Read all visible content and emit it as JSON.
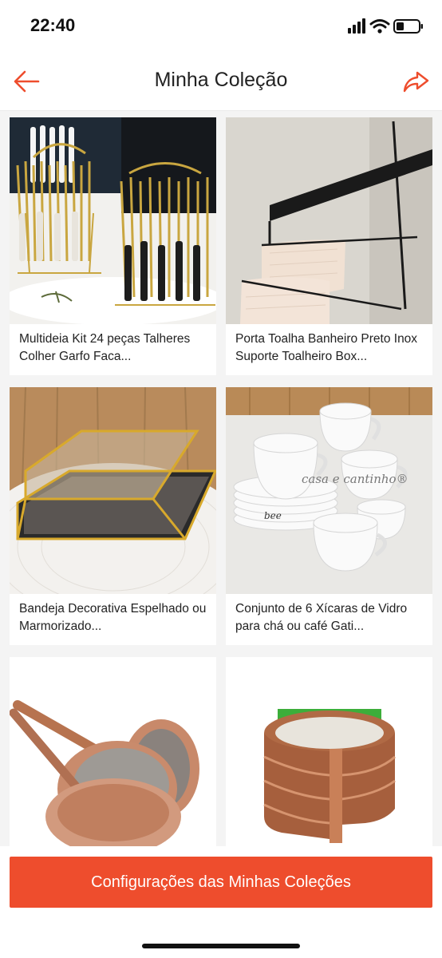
{
  "status_bar": {
    "time": "22:40"
  },
  "nav": {
    "title": "Minha Coleção",
    "back_icon": "arrow-left-icon",
    "share_icon": "share-icon"
  },
  "colors": {
    "accent": "#ee4d2d"
  },
  "products": [
    {
      "title": "Multideia Kit 24 peças Talheres Colher Garfo Faca...",
      "image": "cutlery-set-image"
    },
    {
      "title": "Porta Toalha Banheiro Preto Inox Suporte Toalheiro Box...",
      "image": "towel-rack-image"
    },
    {
      "title": "Bandeja Decorativa Espelhado ou Marmorizado...",
      "image": "mirror-tray-image"
    },
    {
      "title": "Conjunto de 6 Xícaras de Vidro para chá ou café Gati...",
      "image": "tea-cups-image",
      "image_watermark": "casa e cantinho®",
      "cup_text": "bee"
    },
    {
      "title": "",
      "image": "frying-pans-image"
    },
    {
      "title": "",
      "image": "wood-edge-tape-image"
    }
  ],
  "footer": {
    "button_label": "Configurações das Minhas Coleções"
  }
}
